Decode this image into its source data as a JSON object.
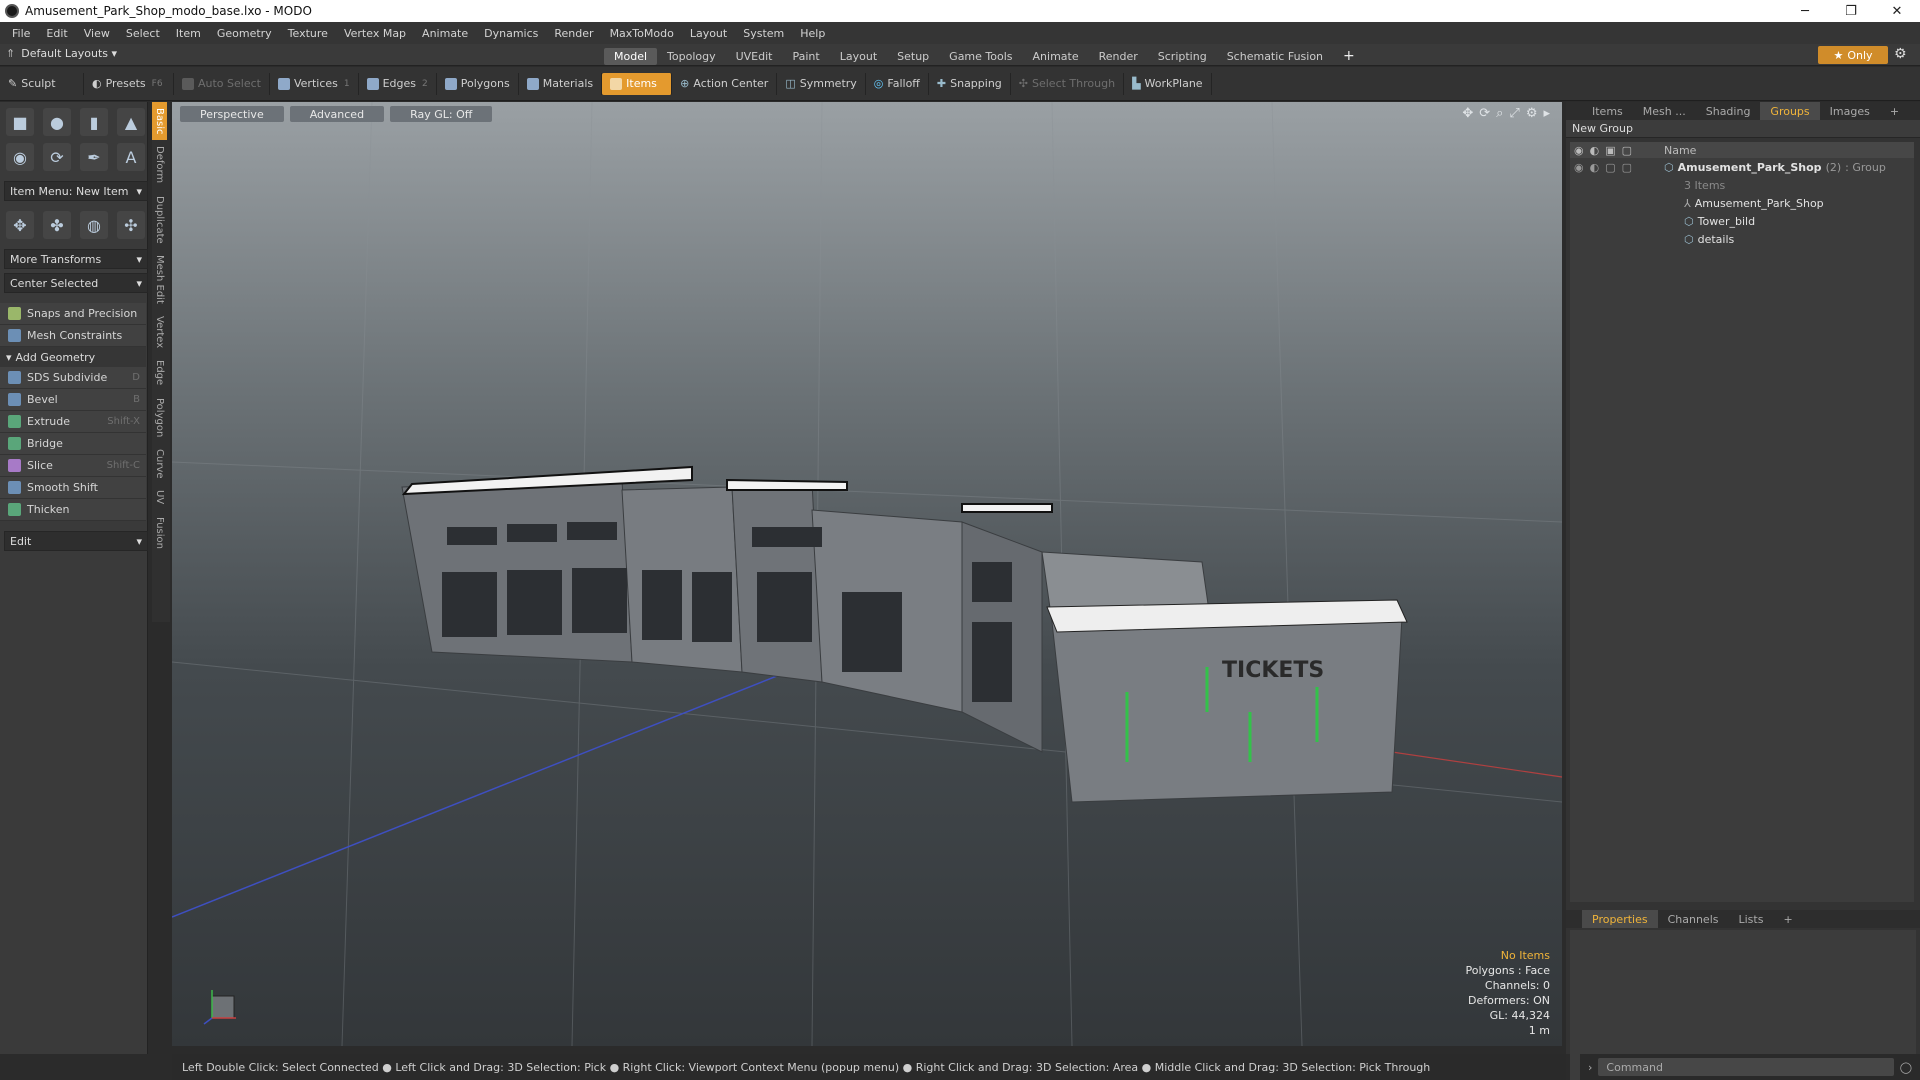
{
  "window": {
    "title": "Amusement_Park_Shop_modo_base.lxo - MODO",
    "minimize": "─",
    "maximize": "❐",
    "close": "✕"
  },
  "menu": [
    "File",
    "Edit",
    "View",
    "Select",
    "Item",
    "Geometry",
    "Texture",
    "Vertex Map",
    "Animate",
    "Dynamics",
    "Render",
    "MaxToModo",
    "Layout",
    "System",
    "Help"
  ],
  "layouts_label": "Default Layouts ▾",
  "tabs": [
    "Model",
    "Topology",
    "UVEdit",
    "Paint",
    "Layout",
    "Setup",
    "Game Tools",
    "Animate",
    "Render",
    "Scripting",
    "Schematic Fusion"
  ],
  "tab_add": "+",
  "only_label": "Only",
  "toolbar": {
    "sculpt": "Sculpt",
    "presets": "Presets",
    "presets_sc": "F6",
    "auto_select": "Auto Select",
    "vertices": "Vertices",
    "vertices_sc": "1",
    "edges": "Edges",
    "edges_sc": "2",
    "polygons": "Polygons",
    "materials": "Materials",
    "items": "Items",
    "action_center": "Action Center",
    "symmetry": "Symmetry",
    "falloff": "Falloff",
    "snapping": "Snapping",
    "select_through": "Select Through",
    "workplane": "WorkPlane"
  },
  "left": {
    "item_menu": "Item Menu: New Item",
    "more_transforms": "More Transforms",
    "center_selected": "Center Selected",
    "snaps": "Snaps and Precision",
    "mesh_constraints": "Mesh Constraints",
    "add_geometry": "Add Geometry",
    "tools": [
      {
        "label": "SDS Subdivide",
        "sc": "D"
      },
      {
        "label": "Bevel",
        "sc": "B"
      },
      {
        "label": "Extrude",
        "sc": "Shift-X"
      },
      {
        "label": "Bridge",
        "sc": ""
      },
      {
        "label": "Slice",
        "sc": "Shift-C"
      },
      {
        "label": "Smooth Shift",
        "sc": ""
      },
      {
        "label": "Thicken",
        "sc": ""
      }
    ],
    "edit": "Edit",
    "vtabs": [
      "Basic",
      "Deform",
      "Duplicate",
      "Mesh Edit",
      "Vertex",
      "Edge",
      "Polygon",
      "Curve",
      "UV",
      "Fusion"
    ]
  },
  "viewport": {
    "perspective": "Perspective",
    "advanced": "Advanced",
    "raygl": "Ray GL: Off",
    "sign": "TICKETS",
    "info": {
      "items": "No Items",
      "polygons": "Polygons : Face",
      "channels": "Channels: 0",
      "deformers": "Deformers: ON",
      "gl": "GL: 44,324",
      "scale": "1 m"
    }
  },
  "right": {
    "tabs": [
      "Items",
      "Mesh ...",
      "Shading",
      "Groups",
      "Images",
      "+"
    ],
    "new_group": "New Group",
    "name_header": "Name",
    "group_name": "Amusement_Park_Shop",
    "group_count": "(2)",
    "group_type": ": Group",
    "group_items": "3 Items",
    "children": [
      "Amusement_Park_Shop",
      "Tower_bild",
      "details"
    ],
    "prop_tabs": [
      "Properties",
      "Channels",
      "Lists",
      "+"
    ]
  },
  "status": "Left Double Click: Select Connected ● Left Click and Drag: 3D Selection: Pick ● Right Click: Viewport Context Menu (popup menu) ● Right Click and Drag: 3D Selection: Area ● Middle Click and Drag: 3D Selection: Pick Through",
  "command_placeholder": "Command"
}
